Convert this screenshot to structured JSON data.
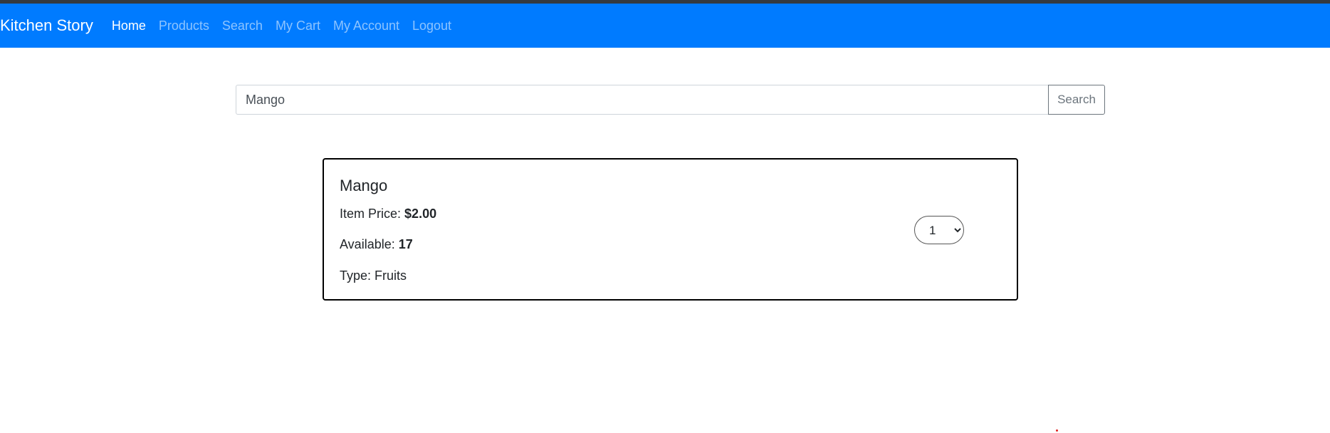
{
  "navbar": {
    "brand": "Kitchen Story",
    "links": [
      {
        "label": "Home"
      },
      {
        "label": "Products"
      },
      {
        "label": "Search"
      },
      {
        "label": "My Cart"
      },
      {
        "label": "My Account"
      },
      {
        "label": "Logout"
      }
    ],
    "active_link": "Home",
    "background_color": "#007bff"
  },
  "search": {
    "value": "Mango",
    "button_label": "Search"
  },
  "product": {
    "name": "Mango",
    "price_label": "Item Price:",
    "price_value": "$2.00",
    "available_label": "Available:",
    "available_value": "17",
    "type_label": "Type:",
    "type_value": "Fruits",
    "quantity_selected": "1"
  }
}
